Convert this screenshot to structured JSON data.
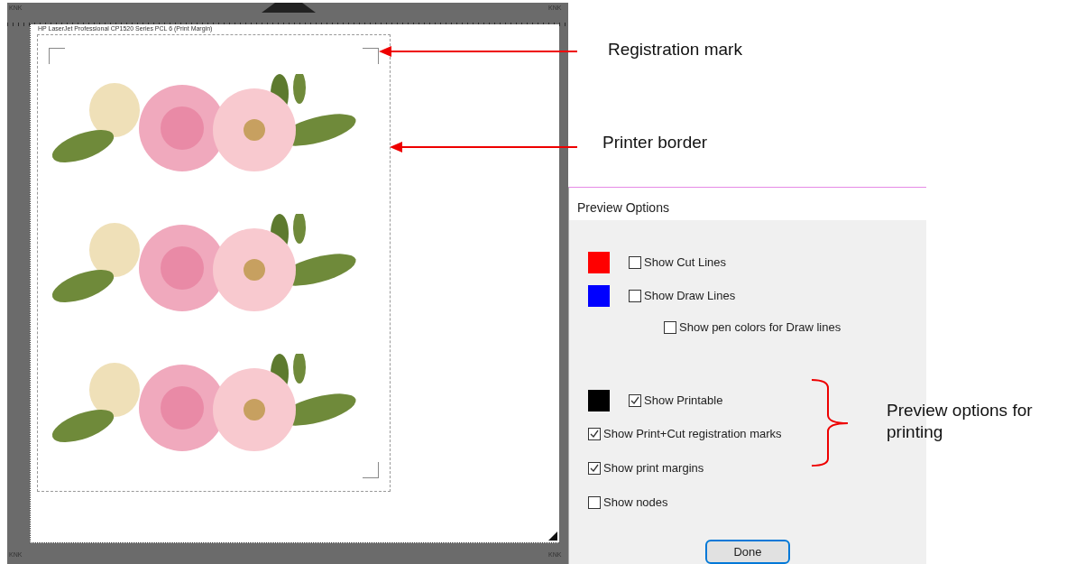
{
  "mat": {
    "corner_labels": [
      "KNK",
      "KNK",
      "KNK",
      "KNK"
    ],
    "printer_label": "HP LaserJet Professional CP1520 Series PCL 6 (Print Margin)",
    "designs": [
      {
        "kind": "flower"
      },
      {
        "kind": "flower"
      },
      {
        "kind": "flower"
      }
    ]
  },
  "dialog": {
    "title": "Preview Options",
    "option_groups": [
      [
        {
          "kind": "swatch",
          "label": "Show Cut Lines",
          "checked": false,
          "color": "#ff0000"
        },
        {
          "kind": "swatch",
          "label": "Show Draw Lines",
          "checked": false,
          "color": "#0000ff"
        },
        {
          "kind": "sub",
          "label": "Show pen colors for Draw lines",
          "checked": false
        }
      ],
      [
        {
          "kind": "swatch",
          "label": "Show Printable",
          "checked": true,
          "color": "#000000"
        },
        {
          "kind": "plain",
          "label": "Show Print+Cut registration marks",
          "checked": true
        },
        {
          "kind": "plain",
          "label": "Show print margins",
          "checked": true
        },
        {
          "kind": "plain",
          "label": "Show nodes",
          "checked": false
        }
      ]
    ],
    "button": "Done"
  },
  "annotations": [
    {
      "kind": "arrow",
      "text": "Registration mark"
    },
    {
      "kind": "arrow",
      "text": "Printer border"
    },
    {
      "kind": "brace",
      "text": "Preview options for printing"
    }
  ]
}
